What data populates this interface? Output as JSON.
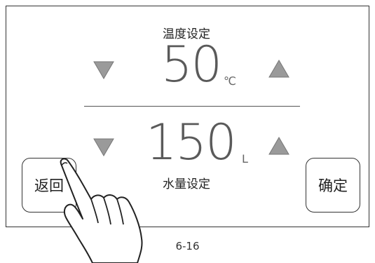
{
  "temperature": {
    "label": "温度设定",
    "value": "50",
    "unit": "℃"
  },
  "water": {
    "label": "水量设定",
    "value": "150",
    "unit": "L"
  },
  "buttons": {
    "back_label": "返回",
    "confirm_label": "确定"
  },
  "footer": {
    "page_ref": "6-16"
  },
  "colors": {
    "arrow_fill": "#9a9a9a",
    "value_text": "#5a5a5a",
    "border": "#333333"
  },
  "icons": {
    "decrease": "triangle-down-icon",
    "increase": "triangle-up-icon",
    "hand": "pointing-hand-icon"
  }
}
